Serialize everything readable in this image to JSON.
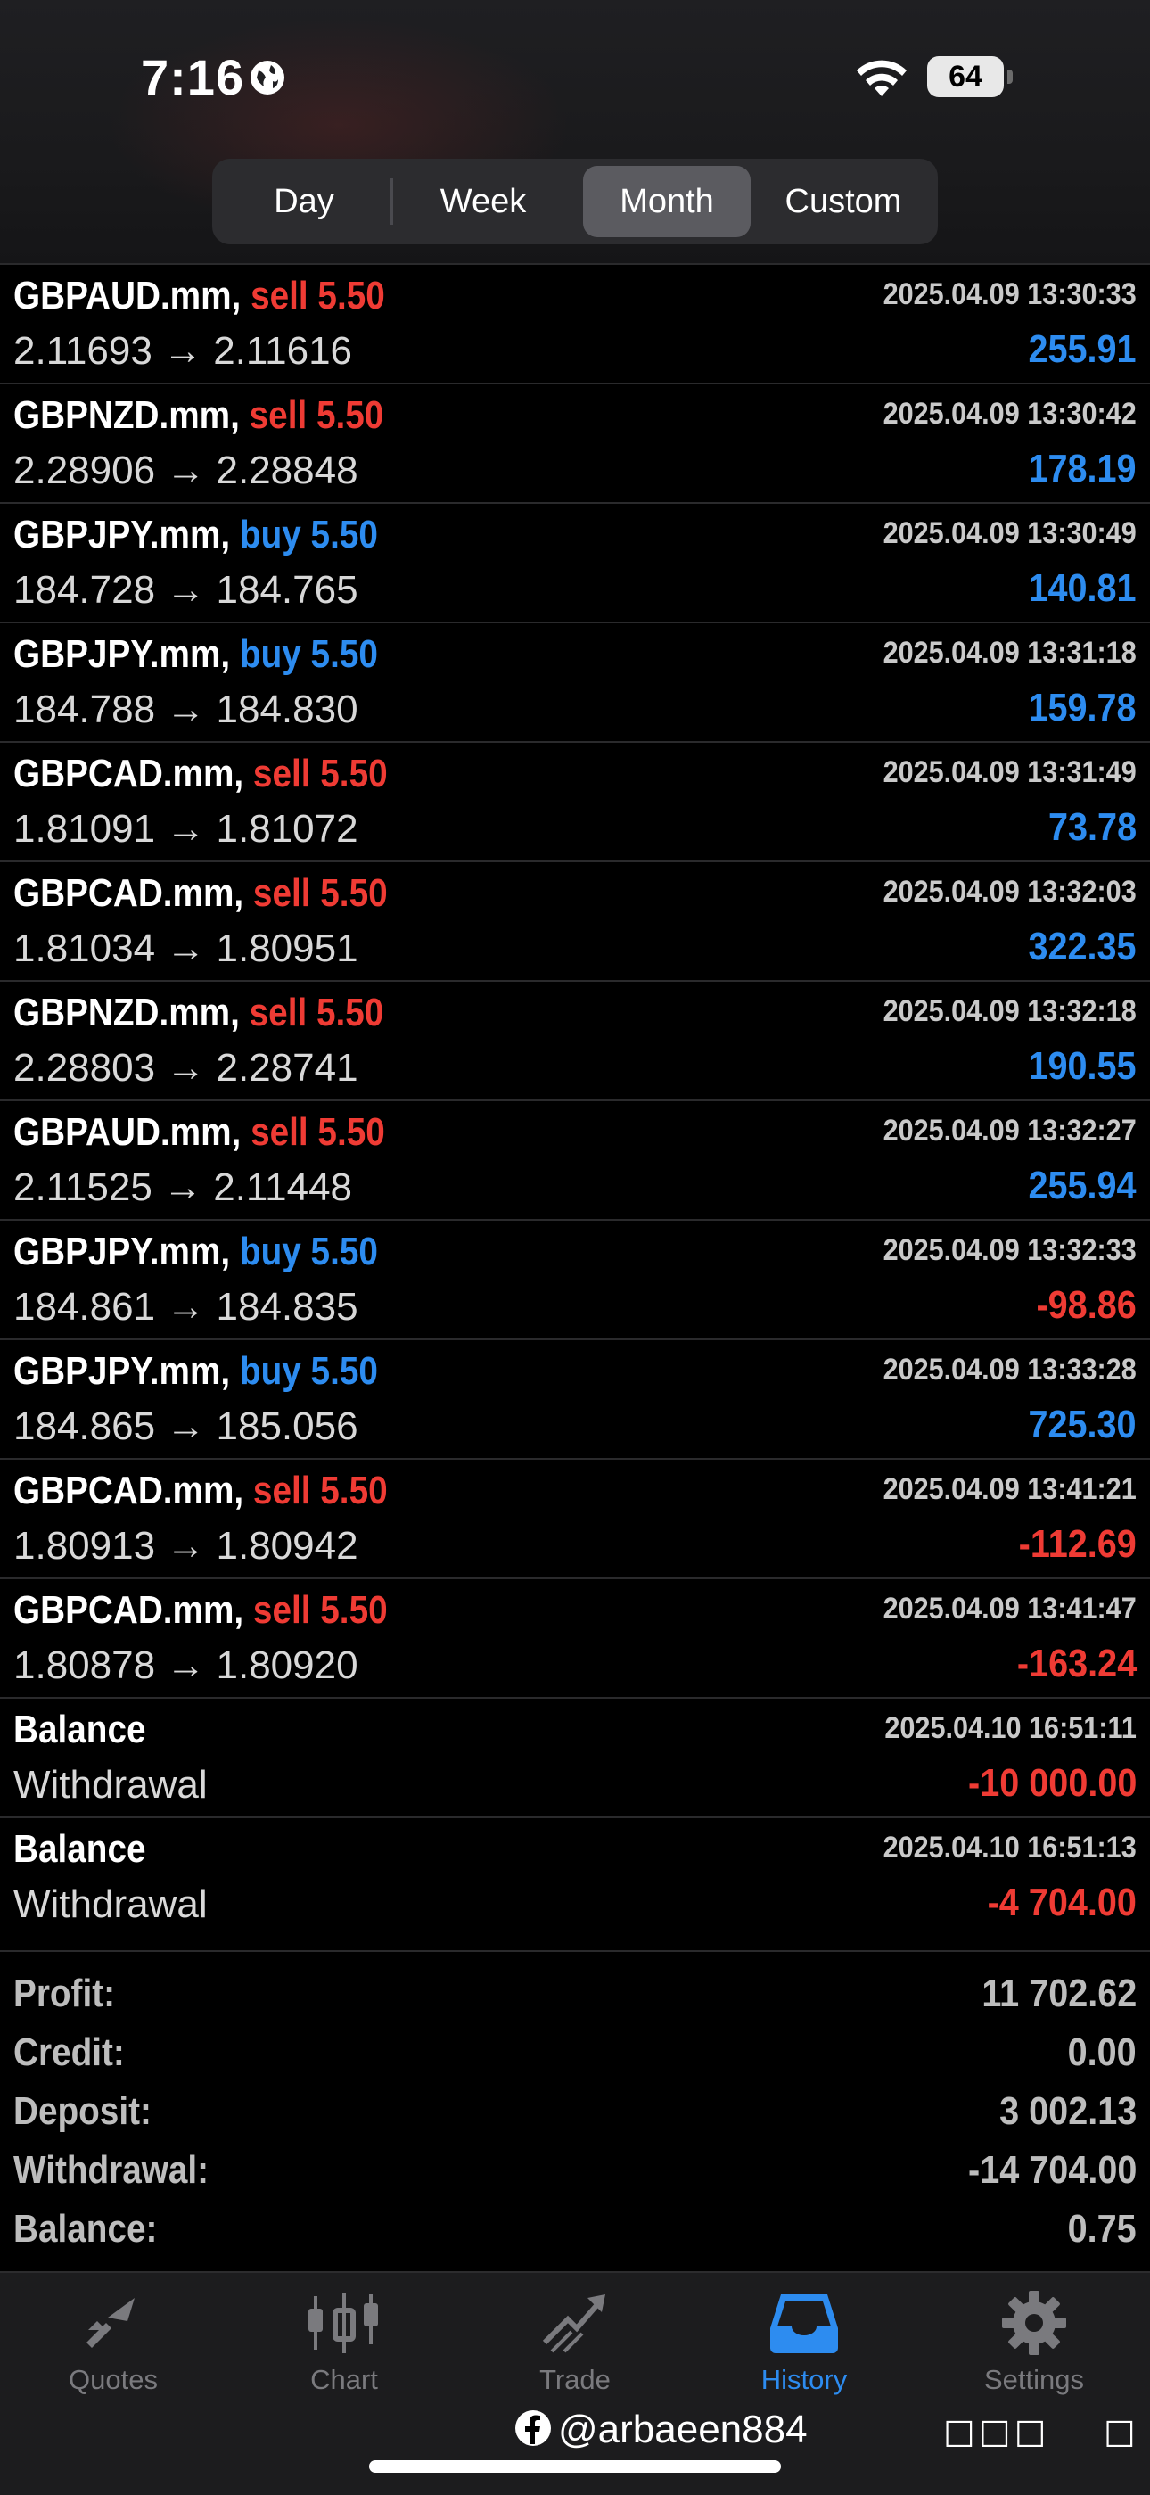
{
  "status_bar": {
    "time": "7:16",
    "battery": "64"
  },
  "period_tabs": [
    {
      "label": "Day",
      "active": false
    },
    {
      "label": "Week",
      "active": false
    },
    {
      "label": "Month",
      "active": true
    },
    {
      "label": "Custom",
      "active": false
    }
  ],
  "trades": [
    {
      "symbol": "GBPAUD.mm,",
      "side": "sell 5.50",
      "side_type": "sell",
      "prices": "2.11693 → 2.11616",
      "time": "2025.04.09 13:30:33",
      "profit": "255.91",
      "profit_sign": "pos"
    },
    {
      "symbol": "GBPNZD.mm,",
      "side": "sell 5.50",
      "side_type": "sell",
      "prices": "2.28906 → 2.28848",
      "time": "2025.04.09 13:30:42",
      "profit": "178.19",
      "profit_sign": "pos"
    },
    {
      "symbol": "GBPJPY.mm,",
      "side": "buy 5.50",
      "side_type": "buy",
      "prices": "184.728 → 184.765",
      "time": "2025.04.09 13:30:49",
      "profit": "140.81",
      "profit_sign": "pos"
    },
    {
      "symbol": "GBPJPY.mm,",
      "side": "buy 5.50",
      "side_type": "buy",
      "prices": "184.788 → 184.830",
      "time": "2025.04.09 13:31:18",
      "profit": "159.78",
      "profit_sign": "pos"
    },
    {
      "symbol": "GBPCAD.mm,",
      "side": "sell 5.50",
      "side_type": "sell",
      "prices": "1.81091 → 1.81072",
      "time": "2025.04.09 13:31:49",
      "profit": "73.78",
      "profit_sign": "pos"
    },
    {
      "symbol": "GBPCAD.mm,",
      "side": "sell 5.50",
      "side_type": "sell",
      "prices": "1.81034 → 1.80951",
      "time": "2025.04.09 13:32:03",
      "profit": "322.35",
      "profit_sign": "pos"
    },
    {
      "symbol": "GBPNZD.mm,",
      "side": "sell 5.50",
      "side_type": "sell",
      "prices": "2.28803 → 2.28741",
      "time": "2025.04.09 13:32:18",
      "profit": "190.55",
      "profit_sign": "pos"
    },
    {
      "symbol": "GBPAUD.mm,",
      "side": "sell 5.50",
      "side_type": "sell",
      "prices": "2.11525 → 2.11448",
      "time": "2025.04.09 13:32:27",
      "profit": "255.94",
      "profit_sign": "pos"
    },
    {
      "symbol": "GBPJPY.mm,",
      "side": "buy 5.50",
      "side_type": "buy",
      "prices": "184.861 → 184.835",
      "time": "2025.04.09 13:32:33",
      "profit": "-98.86",
      "profit_sign": "neg"
    },
    {
      "symbol": "GBPJPY.mm,",
      "side": "buy 5.50",
      "side_type": "buy",
      "prices": "184.865 → 185.056",
      "time": "2025.04.09 13:33:28",
      "profit": "725.30",
      "profit_sign": "pos"
    },
    {
      "symbol": "GBPCAD.mm,",
      "side": "sell 5.50",
      "side_type": "sell",
      "prices": "1.80913 → 1.80942",
      "time": "2025.04.09 13:41:21",
      "profit": "-112.69",
      "profit_sign": "neg"
    },
    {
      "symbol": "GBPCAD.mm,",
      "side": "sell 5.50",
      "side_type": "sell",
      "prices": "1.80878 → 1.80920",
      "time": "2025.04.09 13:41:47",
      "profit": "-163.24",
      "profit_sign": "neg"
    },
    {
      "symbol": "Balance",
      "side": "",
      "side_type": "none",
      "prices": "Withdrawal",
      "time": "2025.04.10 16:51:11",
      "profit": "-10 000.00",
      "profit_sign": "neg"
    },
    {
      "symbol": "Balance",
      "side": "",
      "side_type": "none",
      "prices": "Withdrawal",
      "time": "2025.04.10 16:51:13",
      "profit": "-4 704.00",
      "profit_sign": "neg"
    }
  ],
  "summary": [
    {
      "label": "Profit:",
      "value": "11 702.62"
    },
    {
      "label": "Credit:",
      "value": "0.00"
    },
    {
      "label": "Deposit:",
      "value": "3 002.13"
    },
    {
      "label": "Withdrawal:",
      "value": "-14 704.00"
    },
    {
      "label": "Balance:",
      "value": "0.75"
    }
  ],
  "tabbar": [
    {
      "label": "Quotes",
      "icon": "quotes-icon",
      "active": false
    },
    {
      "label": "Chart",
      "icon": "chart-icon",
      "active": false
    },
    {
      "label": "Trade",
      "icon": "trade-icon",
      "active": false
    },
    {
      "label": "History",
      "icon": "history-icon",
      "active": true
    },
    {
      "label": "Settings",
      "icon": "gear-icon",
      "active": false
    }
  ],
  "watermark": "@arbaeen884",
  "colors": {
    "sell": "#ef3b34",
    "buy": "#2d8cf0",
    "active_tab": "#2d8cf0"
  }
}
